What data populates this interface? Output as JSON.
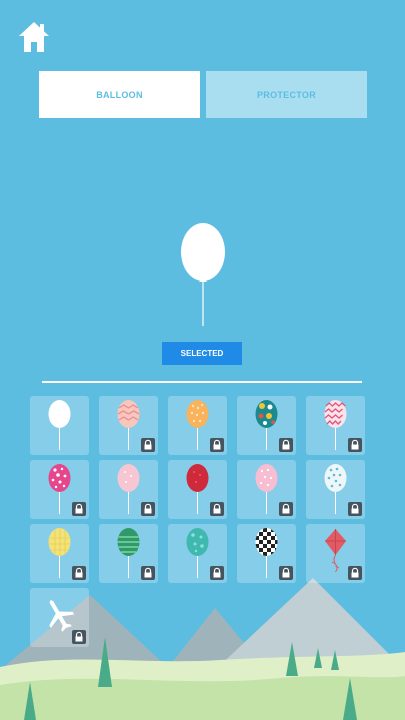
{
  "tabs": [
    {
      "label": "BALLOON",
      "active": true
    },
    {
      "label": "PROTECTOR",
      "active": false
    }
  ],
  "preview": {
    "item": "white-balloon",
    "color": "#ffffff"
  },
  "select_button": {
    "label": "SELECTED"
  },
  "grid": {
    "items": [
      {
        "icon": "white-balloon",
        "locked": false
      },
      {
        "icon": "pink-chevron-balloon",
        "locked": true
      },
      {
        "icon": "orange-dotted-balloon",
        "locked": true
      },
      {
        "icon": "polka-dot-balloon",
        "locked": true
      },
      {
        "icon": "zigzag-balloon",
        "locked": true
      },
      {
        "icon": "pink-floral-balloon",
        "locked": true
      },
      {
        "icon": "light-pink-balloon",
        "locked": true
      },
      {
        "icon": "red-balloon",
        "locked": true
      },
      {
        "icon": "pink-dotted-balloon",
        "locked": true
      },
      {
        "icon": "white-dotted-balloon",
        "locked": true
      },
      {
        "icon": "yellow-balloon",
        "locked": true
      },
      {
        "icon": "green-striped-balloon",
        "locked": true
      },
      {
        "icon": "teal-balloon",
        "locked": true
      },
      {
        "icon": "checkered-balloon",
        "locked": true
      },
      {
        "icon": "red-kite",
        "locked": true
      },
      {
        "icon": "airplane",
        "locked": true
      }
    ]
  },
  "colors": {
    "sky": "#5cbde0",
    "accent": "#1f8be6",
    "lock": "#45545f"
  }
}
